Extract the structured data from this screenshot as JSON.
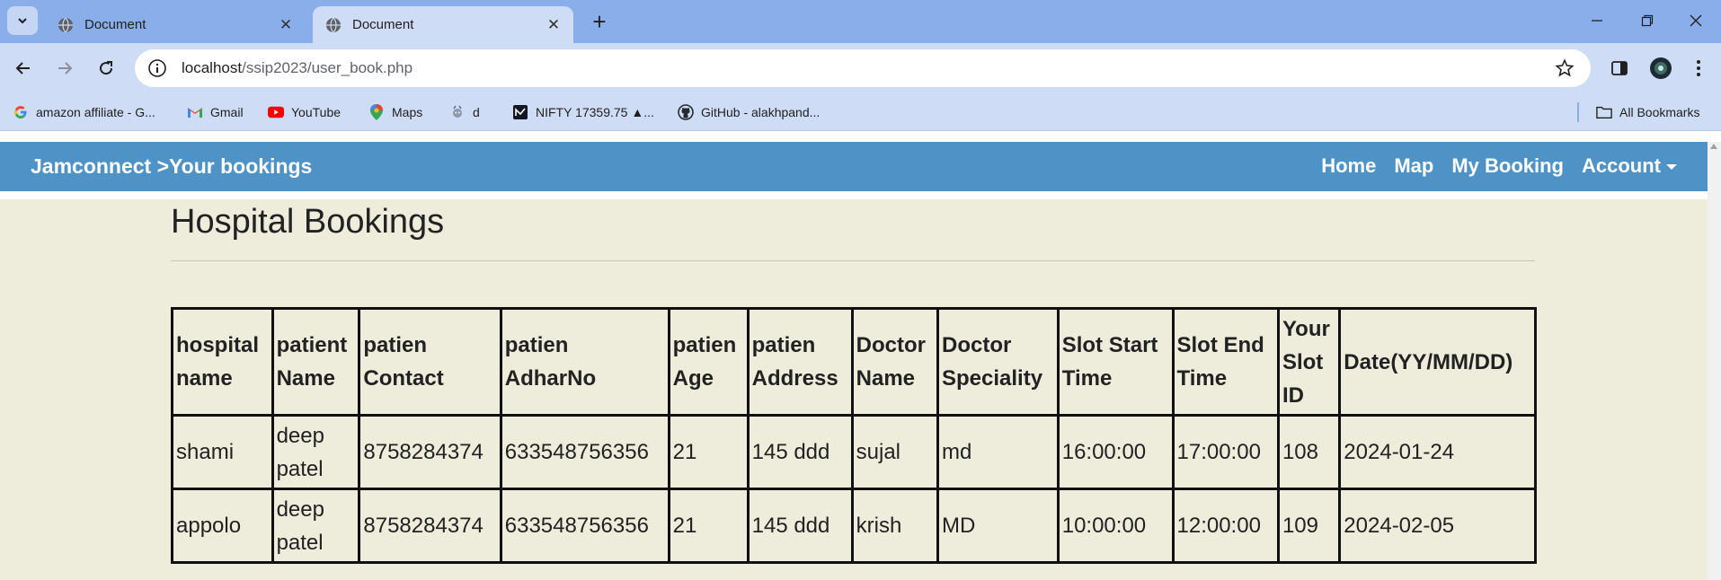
{
  "browser": {
    "tabs": [
      {
        "title": "Document",
        "active": false
      },
      {
        "title": "Document",
        "active": true
      }
    ],
    "new_tab_label": "+",
    "url_host": "localhost",
    "url_path": "/ssip2023/user_book.php",
    "bookmarks": [
      {
        "label": "amazon affiliate - G...",
        "icon": "google-icon"
      },
      {
        "label": "Gmail",
        "icon": "gmail-icon"
      },
      {
        "label": "YouTube",
        "icon": "youtube-icon"
      },
      {
        "label": "Maps",
        "icon": "maps-icon"
      },
      {
        "label": "d",
        "icon": "bookmark-favicon"
      },
      {
        "label": "NIFTY 17359.75 ▲...",
        "icon": "nifty-icon"
      },
      {
        "label": "GitHub - alakhpand...",
        "icon": "github-icon"
      }
    ],
    "all_bookmarks_label": "All Bookmarks",
    "colors": {
      "tabstrip": "#8aaee9",
      "toolbar": "#cfdcf5"
    }
  },
  "app": {
    "brand": "Jamconnect >Your bookings",
    "nav_links": {
      "home": "Home",
      "map": "Map",
      "my_booking": "My Booking",
      "account": "Account"
    },
    "colors": {
      "navbar": "#4f93c6",
      "background": "#eeeddc"
    }
  },
  "main": {
    "title": "Hospital Bookings",
    "table": {
      "headers": [
        [
          "hospital",
          "name"
        ],
        [
          "patient",
          "Name"
        ],
        [
          "patien",
          "Contact"
        ],
        [
          "patien",
          "AdharNo"
        ],
        [
          "patien",
          "Age"
        ],
        [
          "patien",
          "Address"
        ],
        [
          "Doctor",
          "Name"
        ],
        [
          "Doctor",
          "Speciality"
        ],
        [
          "Slot Start",
          "Time"
        ],
        [
          "Slot End",
          "Time"
        ],
        [
          "Your",
          "Slot",
          "ID"
        ],
        [
          "Date(YY/MM/DD)"
        ]
      ],
      "rows": [
        [
          [
            "shami"
          ],
          [
            "deep",
            "patel"
          ],
          [
            "8758284374"
          ],
          [
            "633548756356"
          ],
          [
            "21"
          ],
          [
            "145 ddd"
          ],
          [
            "sujal"
          ],
          [
            "md"
          ],
          [
            "16:00:00"
          ],
          [
            "17:00:00"
          ],
          [
            "108"
          ],
          [
            "2024-01-24"
          ]
        ],
        [
          [
            "appolo"
          ],
          [
            "deep",
            "patel"
          ],
          [
            "8758284374"
          ],
          [
            "633548756356"
          ],
          [
            "21"
          ],
          [
            "145 ddd"
          ],
          [
            "krish"
          ],
          [
            "MD"
          ],
          [
            "10:00:00"
          ],
          [
            "12:00:00"
          ],
          [
            "109"
          ],
          [
            "2024-02-05"
          ]
        ]
      ]
    }
  }
}
